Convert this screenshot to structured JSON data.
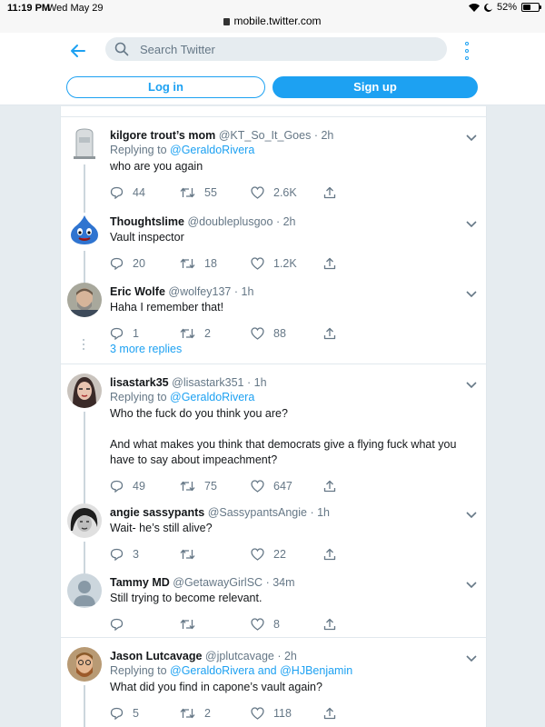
{
  "status_bar": {
    "time": "11:19 PM",
    "date": "Wed May 29",
    "url": "mobile.twitter.com",
    "battery": "52%",
    "battery_level": 0.52
  },
  "header": {
    "search_placeholder": "Search Twitter",
    "login_label": "Log in",
    "signup_label": "Sign up"
  },
  "colors": {
    "accent": "#1da1f2",
    "muted": "#657786",
    "background": "#e6ecf0"
  },
  "tweets": [
    {
      "name": "kilgore trout’s mom",
      "handle": "@KT_So_It_Goes",
      "time": "· 2h",
      "replying_prefix": "Replying to ",
      "replying_to": "@GeraldoRivera",
      "text": "who are you again",
      "replies": "44",
      "retweets": "55",
      "likes": "2.6K"
    },
    {
      "name": "Thoughtslime",
      "handle": "@doubleplusgoo",
      "time": "· 2h",
      "text": "Vault inspector",
      "replies": "20",
      "retweets": "18",
      "likes": "1.2K"
    },
    {
      "name": "Eric Wolfe",
      "handle": "@wolfey137",
      "time": "· 1h",
      "text": "Haha I remember that!",
      "replies": "1",
      "retweets": "2",
      "likes": "88"
    },
    {
      "name": "lisastark35",
      "handle": "@lisastark351",
      "time": "· 1h",
      "replying_prefix": "Replying to ",
      "replying_to": "@GeraldoRivera",
      "text": "Who the fuck do you think you are?\n\nAnd what makes you think that democrats give a flying fuck what you have to say about impeachment?",
      "replies": "49",
      "retweets": "75",
      "likes": "647"
    },
    {
      "name": "angie sassypants",
      "handle": "@SassypantsAngie",
      "time": "· 1h",
      "text": "Wait- he’s still alive?",
      "replies": "3",
      "retweets": "",
      "likes": "22"
    },
    {
      "name": "Tammy MD",
      "handle": "@GetawayGirlSC",
      "time": "· 34m",
      "text": "Still trying to become relevant.",
      "replies": "",
      "retweets": "",
      "likes": "8"
    },
    {
      "name": "Jason Lutcavage",
      "handle": "@jplutcavage",
      "time": "· 2h",
      "replying_prefix": "Replying to ",
      "replying_to": "@GeraldoRivera",
      "replying_and": " and ",
      "replying_to_2": "@HJBenjamin",
      "text": "What did you find in capone’s vault again?",
      "replies": "5",
      "retweets": "2",
      "likes": "118"
    }
  ],
  "more_replies": "3 more replies"
}
